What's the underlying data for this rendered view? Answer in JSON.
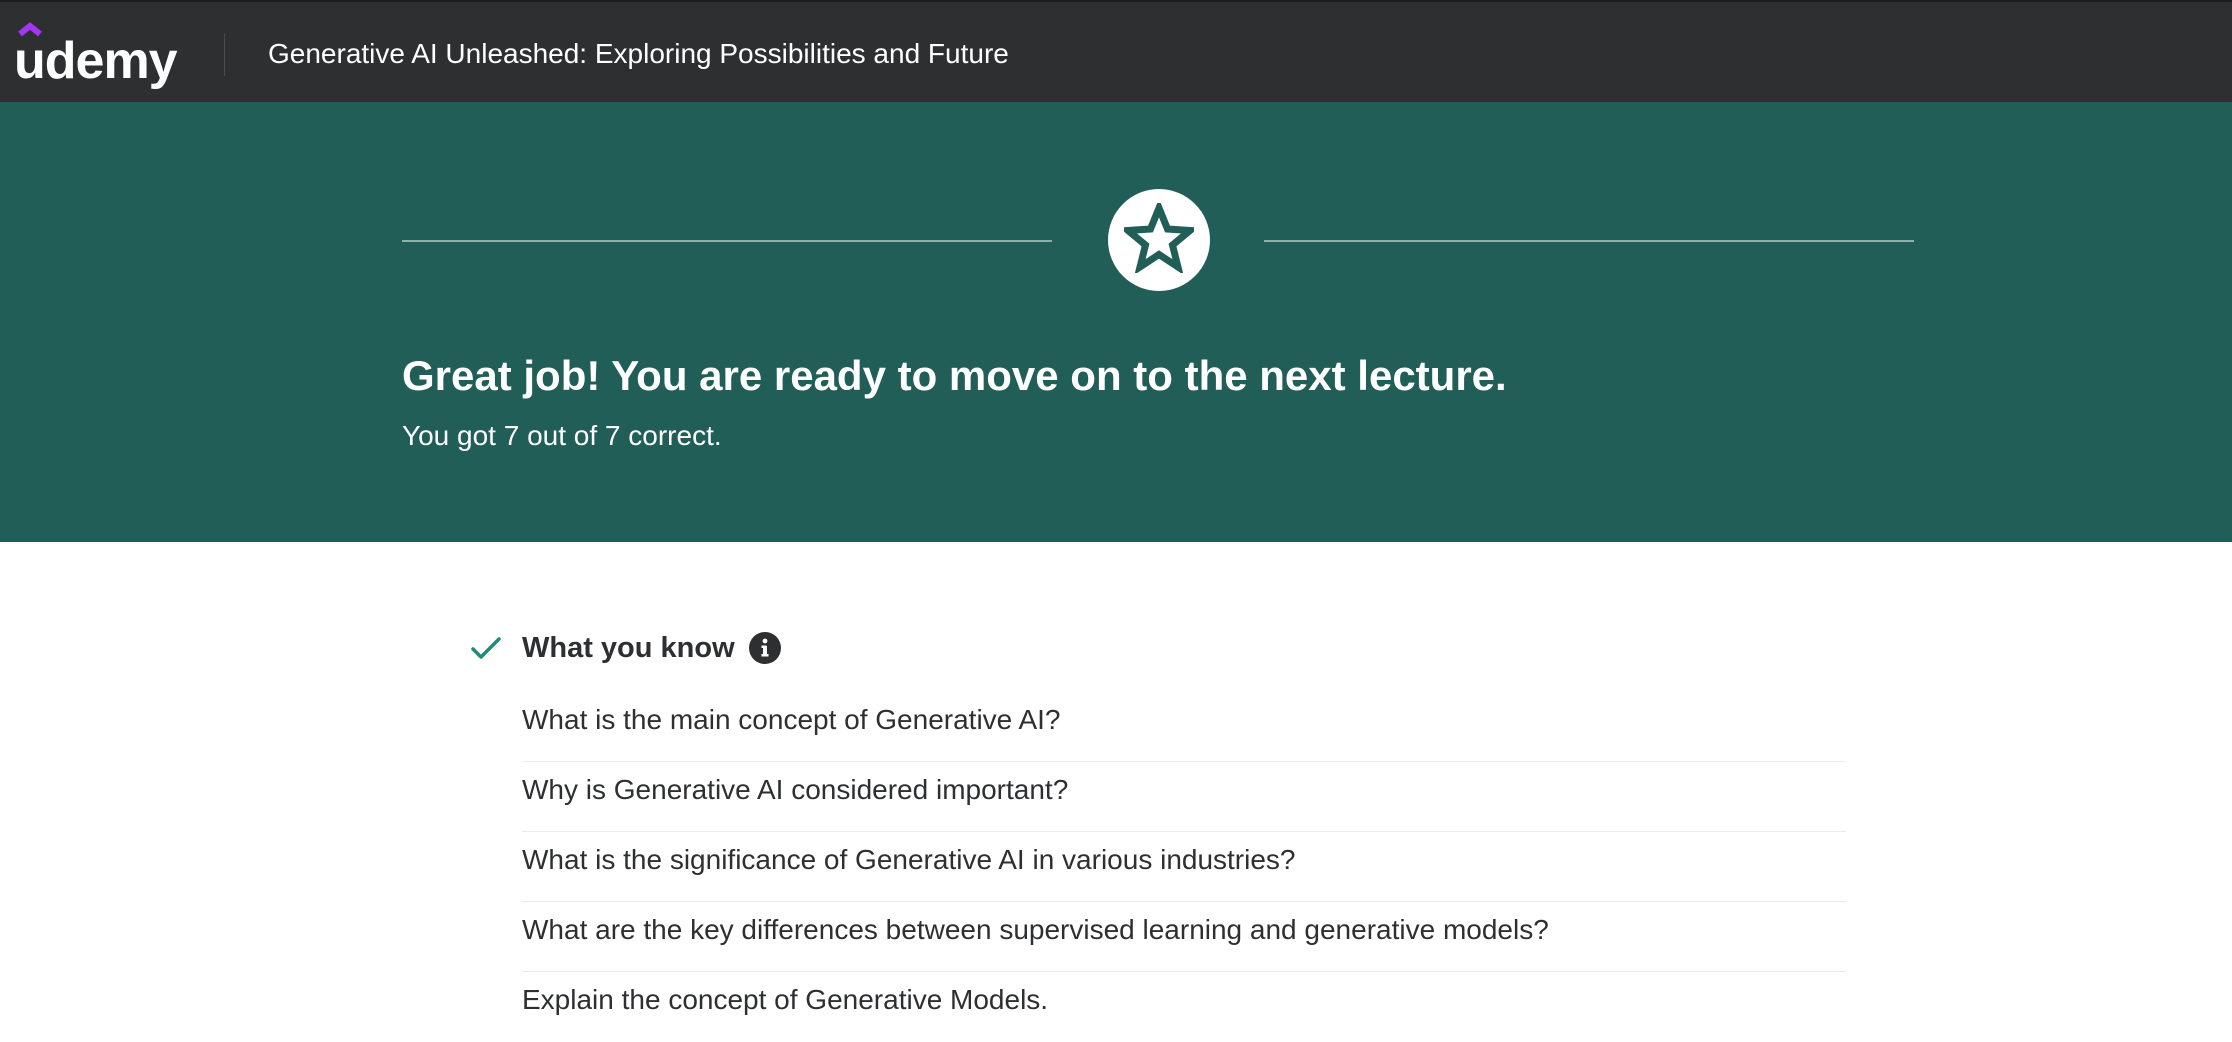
{
  "header": {
    "logo": {
      "text": "udemy",
      "accent_color": "#a435f0"
    },
    "course_title": "Generative AI Unleashed: Exploring Possibilities and Future"
  },
  "result": {
    "badge_icon": "star-icon",
    "heading": "Great job! You are ready to move on to the next lecture.",
    "score_text": "You got 7 out of 7 correct.",
    "correct": 7,
    "total": 7,
    "banner_color": "#205e57"
  },
  "knowledge": {
    "title": "What you know",
    "status_icon": "check-icon",
    "status_color": "#1e8c76",
    "info_icon": "info-icon",
    "topics": [
      "What is the main concept of Generative AI?",
      "Why is Generative AI considered important?",
      "What is the significance of Generative AI in various industries?",
      "What are the key differences between supervised learning and generative models?",
      "Explain the concept of Generative Models."
    ]
  }
}
